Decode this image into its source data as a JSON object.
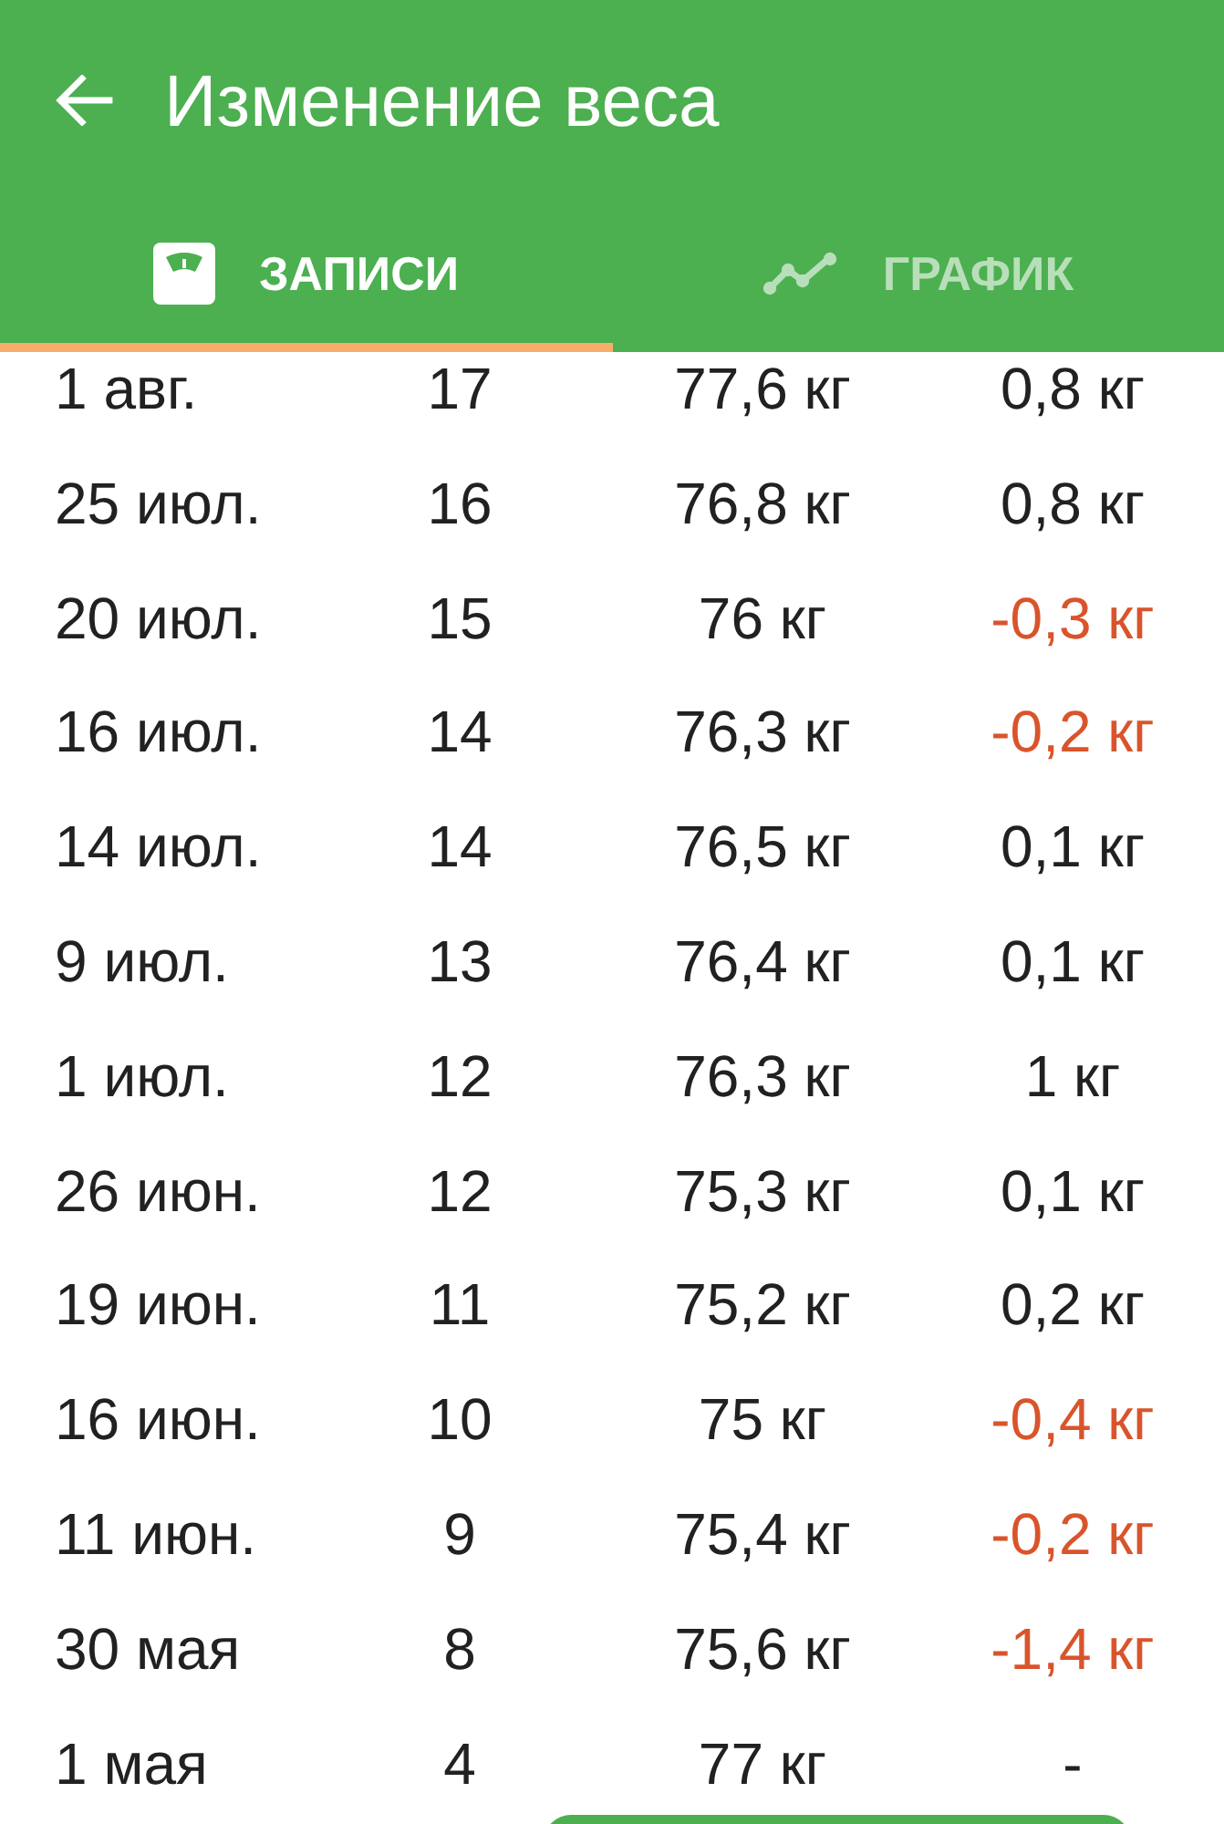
{
  "toolbar": {
    "title": "Изменение веса"
  },
  "tabs": [
    {
      "label": "ЗАПИСИ",
      "selected": true
    },
    {
      "label": "ГРАФИК",
      "selected": false
    }
  ],
  "rows": [
    {
      "date": "1 авг.",
      "number": "17",
      "weight": "77,6 кг",
      "change": "0,8 кг",
      "color": "#212121"
    },
    {
      "date": "25 июл.",
      "number": "16",
      "weight": "76,8 кг",
      "change": "0,8 кг",
      "color": "#212121"
    },
    {
      "date": "20 июл.",
      "number": "15",
      "weight": "76 кг",
      "change": "-0,3 кг",
      "color": "#d9542b"
    },
    {
      "date": "16 июл.",
      "number": "14",
      "weight": "76,3 кг",
      "change": "-0,2 кг",
      "color": "#d9542b"
    },
    {
      "date": "14 июл.",
      "number": "14",
      "weight": "76,5 кг",
      "change": "0,1 кг",
      "color": "#212121"
    },
    {
      "date": "9 июл.",
      "number": "13",
      "weight": "76,4 кг",
      "change": "0,1 кг",
      "color": "#212121"
    },
    {
      "date": "1 июл.",
      "number": "12",
      "weight": "76,3 кг",
      "change": "1 кг",
      "color": "#212121"
    },
    {
      "date": "26 июн.",
      "number": "12",
      "weight": "75,3 кг",
      "change": "0,1 кг",
      "color": "#212121"
    },
    {
      "date": "19 июн.",
      "number": "11",
      "weight": "75,2 кг",
      "change": "0,2 кг",
      "color": "#212121"
    },
    {
      "date": "16 июн.",
      "number": "10",
      "weight": "75 кг",
      "change": "-0,4 кг",
      "color": "#d9542b"
    },
    {
      "date": "11 июн.",
      "number": "9",
      "weight": "75,4 кг",
      "change": "-0,2 кг",
      "color": "#d9542b"
    },
    {
      "date": "30 мая",
      "number": "8",
      "weight": "75,6 кг",
      "change": "-1,4 кг",
      "color": "#d9542b"
    },
    {
      "date": "1 мая",
      "number": "4",
      "weight": "77 кг",
      "change": "-",
      "color": "#212121"
    }
  ]
}
